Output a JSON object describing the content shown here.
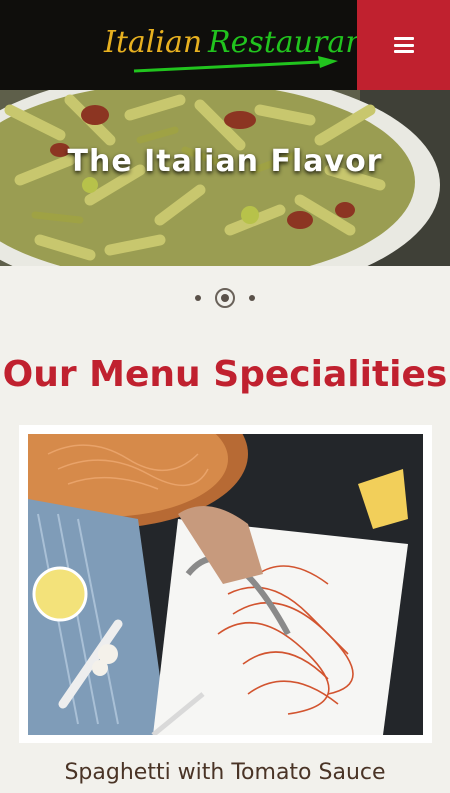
{
  "header": {
    "logo_text": "Italian Restaurant",
    "logo_first_word": "Italian",
    "logo_second_word": "Restaurant",
    "menu_icon": "hamburger-icon"
  },
  "hero": {
    "title": "The Italian Flavor",
    "slides": {
      "count": 3,
      "active_index": 1
    }
  },
  "specialities": {
    "title": "Our Menu Specialities",
    "items": [
      {
        "name": "Spaghetti with Tomato Sauce"
      }
    ]
  },
  "colors": {
    "accent_red": "#c0212f",
    "header_bg": "#0f0e0c",
    "logo_gold": "#e8b120",
    "logo_green": "#21c41e",
    "page_bg": "#f2f1ec",
    "text_brown": "#4a3426"
  }
}
